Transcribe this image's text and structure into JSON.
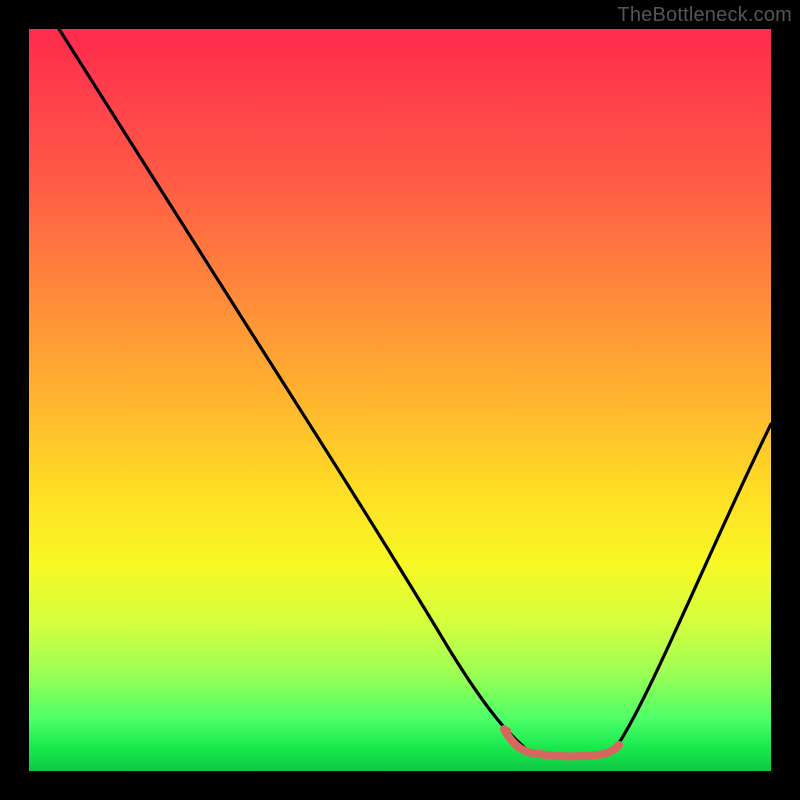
{
  "attribution": "TheBottleneck.com",
  "colors": {
    "background": "#000000",
    "gradient_top": "#ff2a4d",
    "gradient_mid": "#ffdd25",
    "gradient_bottom": "#0fc844",
    "curve": "#000000",
    "accent": "#d6675f"
  },
  "chart_data": {
    "type": "line",
    "title": "",
    "xlabel": "",
    "ylabel": "",
    "xlim": [
      0,
      100
    ],
    "ylim": [
      0,
      100
    ],
    "grid": false,
    "legend": false,
    "series": [
      {
        "name": "left-curve",
        "x": [
          4,
          10,
          20,
          30,
          40,
          50,
          60,
          64,
          67
        ],
        "y": [
          100,
          92,
          77,
          62,
          47,
          31,
          14,
          6,
          3
        ]
      },
      {
        "name": "right-curve",
        "x": [
          79,
          82,
          86,
          90,
          94,
          98,
          100
        ],
        "y": [
          3,
          7,
          15,
          25,
          36,
          47,
          53
        ]
      },
      {
        "name": "valley-accent",
        "color": "#d6675f",
        "x": [
          64,
          67,
          70,
          73,
          76,
          79
        ],
        "y": [
          6,
          3,
          2,
          2,
          3,
          3
        ]
      }
    ],
    "annotations": []
  }
}
